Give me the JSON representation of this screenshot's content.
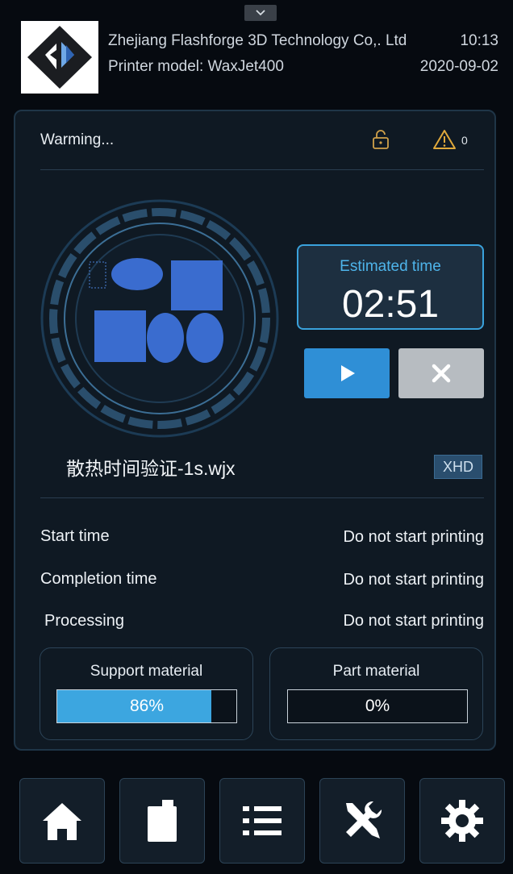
{
  "header": {
    "company": "Zhejiang Flashforge 3D Technology Co,. Ltd",
    "printer_model": "Printer model:  WaxJet400",
    "time": "10:13",
    "date": "2020-09-02"
  },
  "status": {
    "text": "Warming...",
    "warning_count": "0"
  },
  "job": {
    "estimated_time_label": "Estimated time",
    "estimated_time_value": "02:51",
    "filename": "散热时间验证-1s.wjx",
    "quality": "XHD"
  },
  "info_rows": [
    {
      "label": "Start time",
      "value": "Do not start printing"
    },
    {
      "label": "Completion time",
      "value": "Do not start printing"
    },
    {
      "label": "Processing",
      "value": "Do not start printing"
    }
  ],
  "materials": {
    "support": {
      "label": "Support material",
      "percent_text": "86%",
      "fraction": 0.86
    },
    "part": {
      "label": "Part material",
      "percent_text": "0%",
      "fraction": 0.0
    }
  },
  "icons": {
    "logo": "flashforge-logo",
    "lock": "unlock-icon",
    "warning": "warning-icon",
    "play": "play-icon",
    "stop": "close-icon",
    "nav": [
      "home-icon",
      "material-bottle-icon",
      "list-icon",
      "tools-icon",
      "gear-icon"
    ]
  },
  "colors": {
    "accent": "#3aa2dc",
    "background": "#060a10",
    "panel": "#0f1923"
  }
}
